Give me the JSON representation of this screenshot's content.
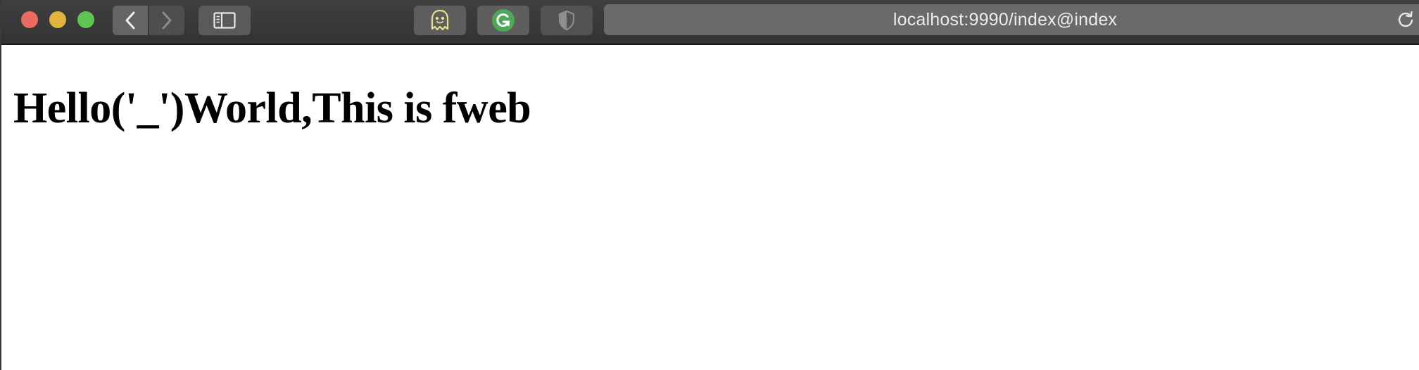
{
  "browser": {
    "url": "localhost:9990/index@index",
    "icons": {
      "close": "close-dot",
      "minimize": "minimize-dot",
      "maximize": "maximize-dot",
      "back": "chevron-left-icon",
      "forward": "chevron-right-icon",
      "sidebar": "sidebar-icon",
      "extension1": "ghost-icon",
      "extension2": "grammarly-icon",
      "extension3": "shield-icon",
      "reload": "reload-icon"
    },
    "colors": {
      "close": "#ed6a5e",
      "minimize": "#e0b43f",
      "maximize": "#61c454",
      "toolbar": "#3a3a3a",
      "ghost": "#e6e089",
      "grammarly": "#4fa85a"
    }
  },
  "page": {
    "heading": "Hello('_')World,This is fweb"
  }
}
